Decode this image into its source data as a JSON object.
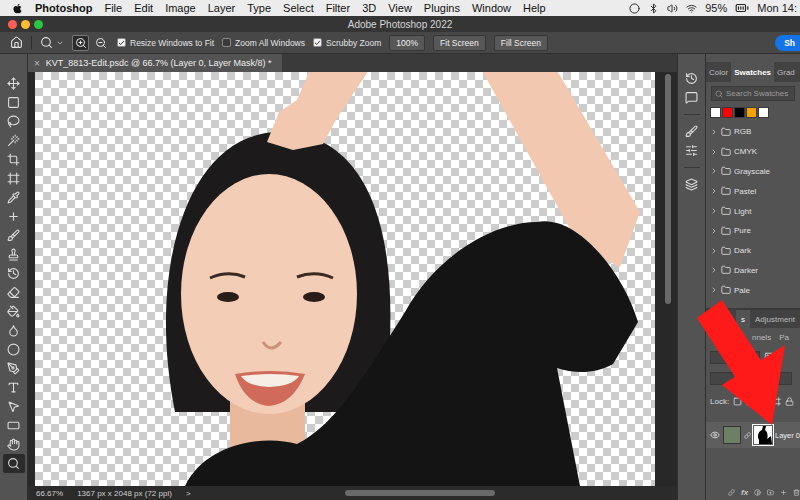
{
  "menu_bar": {
    "app": "Photoshop",
    "items": [
      "File",
      "Edit",
      "Image",
      "Layer",
      "Type",
      "Select",
      "Filter",
      "3D",
      "View",
      "Plugins",
      "Window",
      "Help"
    ],
    "battery": "95%",
    "clock": "Mon 14:"
  },
  "window": {
    "title": "Adobe Photoshop 2022"
  },
  "options_bar": {
    "zoom_modes": [
      {
        "kind": "in",
        "selected": true
      },
      {
        "kind": "out",
        "selected": false
      }
    ],
    "checkboxes": [
      {
        "label": "Resize Windows to Fit",
        "checked": true
      },
      {
        "label": "Zoom All Windows",
        "checked": false
      },
      {
        "label": "Scrubby Zoom",
        "checked": true
      }
    ],
    "zoom_value": "100%",
    "buttons": [
      "Fit Screen",
      "Fill Screen"
    ],
    "share": "Sh"
  },
  "document_tab": {
    "title": "KVT_8813-Edit.psdc @ 66.7% (Layer 0, Layer Mask/8) *",
    "close": "×"
  },
  "tools": [
    {
      "kind": "move",
      "selected": false
    },
    {
      "kind": "marquee",
      "selected": false
    },
    {
      "kind": "lasso",
      "selected": false
    },
    {
      "kind": "quick-select",
      "selected": false
    },
    {
      "kind": "crop",
      "selected": false
    },
    {
      "kind": "frame",
      "selected": false
    },
    {
      "kind": "eyedropper",
      "selected": false
    },
    {
      "kind": "healing",
      "selected": false
    },
    {
      "kind": "brush",
      "selected": false
    },
    {
      "kind": "stamp",
      "selected": false
    },
    {
      "kind": "history",
      "selected": false
    },
    {
      "kind": "eraser",
      "selected": false
    },
    {
      "kind": "gradient",
      "selected": false
    },
    {
      "kind": "blur",
      "selected": false
    },
    {
      "kind": "dodge",
      "selected": false
    },
    {
      "kind": "pen",
      "selected": false
    },
    {
      "kind": "type",
      "selected": false
    },
    {
      "kind": "path-select",
      "selected": false
    },
    {
      "kind": "shape",
      "selected": false
    },
    {
      "kind": "hand",
      "selected": false
    },
    {
      "kind": "zoom",
      "selected": true
    }
  ],
  "status_bar": {
    "zoom": "66.67%",
    "size": "1367 px x 2048 px (72 ppi)",
    "more": ">"
  },
  "swatches_panel": {
    "tabs": [
      {
        "label": "Color",
        "selected": false
      },
      {
        "label": "Swatches",
        "selected": true
      },
      {
        "label": "Grad",
        "selected": false
      }
    ],
    "search": {
      "placeholder": "Search Swatches"
    },
    "recent": [
      {
        "color": "#ffffff"
      },
      {
        "color": "#ff0000"
      },
      {
        "color": "#000000"
      },
      {
        "color": "#f5a300"
      },
      {
        "color": "#ffffff"
      }
    ],
    "groups": [
      {
        "label": "RGB",
        "expanded": false
      },
      {
        "label": "CMYK",
        "expanded": false
      },
      {
        "label": "Grayscale",
        "expanded": false
      },
      {
        "label": "Pastel",
        "expanded": false
      },
      {
        "label": "Light",
        "expanded": false
      },
      {
        "label": "Pure",
        "expanded": false
      },
      {
        "label": "Dark",
        "expanded": false
      },
      {
        "label": "Darker",
        "expanded": false
      },
      {
        "label": "Pale",
        "expanded": false
      }
    ]
  },
  "layers_panel": {
    "tabs": [
      {
        "label": "s",
        "selected": true
      },
      {
        "label": "Adjustment",
        "selected": false
      }
    ],
    "subtabs": [
      {
        "label": "nnels",
        "selected": false
      },
      {
        "label": "Pa",
        "selected": false
      }
    ],
    "lock_label": "Lock:",
    "layers": [
      {
        "name": "Layer 0",
        "visible": true,
        "selected": true,
        "mask_selected": true
      }
    ],
    "footer": [
      "fx"
    ]
  },
  "annotation": {
    "kind": "arrow",
    "color": "#ff1a1a"
  }
}
